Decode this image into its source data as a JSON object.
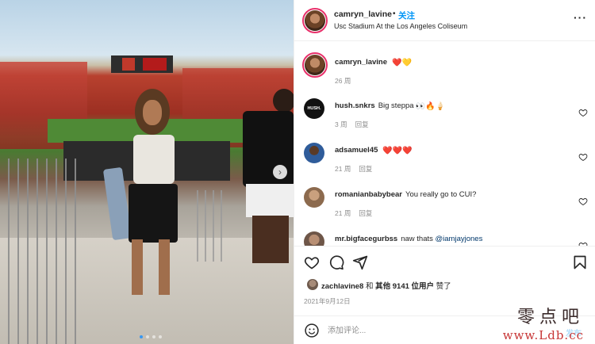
{
  "post": {
    "username": "camryn_lavine",
    "separator": "•",
    "follow_label": "关注",
    "location": "Usc Stadium At the Los Angeles Coliseum",
    "more_icon": "more-horizontal-icon"
  },
  "photo": {
    "scoreboard_icon": "scoreboard",
    "next_icon": "chevron-right-icon",
    "next_glyph": "›",
    "carousel_count": 4,
    "carousel_active": 1
  },
  "comments": [
    {
      "username": "camryn_lavine",
      "text": "",
      "emoji": "❤️💛",
      "time": "26 周",
      "reply": "",
      "avatar": "camryn",
      "has_like": false
    },
    {
      "username": "hush.snkrs",
      "text": "Big steppa",
      "emoji": "👀🔥🍦",
      "time": "3 周",
      "reply": "回复",
      "avatar": "hush",
      "has_like": true
    },
    {
      "username": "adsamuel45",
      "text": "",
      "emoji": "❤️❤️❤️",
      "time": "21 周",
      "reply": "回复",
      "avatar": "ad",
      "has_like": true
    },
    {
      "username": "romanianbabybear",
      "text": "You really go to CUI?",
      "emoji": "",
      "time": "21 周",
      "reply": "回复",
      "avatar": "rom",
      "has_like": true
    },
    {
      "username": "mr.bigfacegurbss",
      "text": "naw thats",
      "mention": "@iamjayjones",
      "emoji": "",
      "time": "",
      "reply": "",
      "avatar": "mr",
      "has_like": true
    }
  ],
  "hush_avatar_text": "HUSH.",
  "actions": {
    "like_icon": "heart-icon",
    "comment_icon": "comment-icon",
    "share_icon": "send-icon",
    "save_icon": "bookmark-icon"
  },
  "likes": {
    "user": "zachlavine8",
    "middle": " 和 ",
    "others": "其他 9141 位用户",
    "suffix": " 赞了"
  },
  "date": "2021年9月12日",
  "add_comment": {
    "placeholder": "添加评论...",
    "post_label": "发布",
    "emoji_icon": "smile-icon"
  },
  "watermark": {
    "line1": "零点吧",
    "line2": "www.Ldb.cc"
  },
  "colors": {
    "accent": "#0095f6",
    "heart": "#ed4956",
    "ring": "#e8306a"
  }
}
